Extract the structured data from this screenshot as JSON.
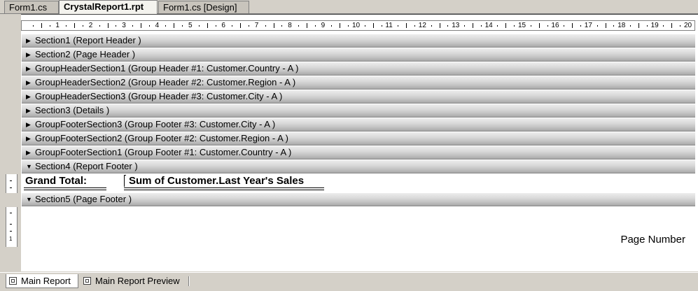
{
  "tabs": [
    {
      "label": "Form1.cs",
      "active": false
    },
    {
      "label": "CrystalReport1.rpt",
      "active": true
    },
    {
      "label": "Form1.cs [Design]",
      "active": false
    }
  ],
  "ruler": {
    "numbers": [
      "1",
      "2",
      "3",
      "4",
      "5",
      "6",
      "7",
      "8",
      "9",
      "10",
      "11",
      "12",
      "13",
      "14",
      "15",
      "16",
      "17",
      "18",
      "19",
      "20"
    ]
  },
  "sections": [
    {
      "label": "Section1 (Report Header )",
      "expanded": false
    },
    {
      "label": "Section2 (Page Header )",
      "expanded": false
    },
    {
      "label": "GroupHeaderSection1 (Group Header #1: Customer.Country - A )",
      "expanded": false
    },
    {
      "label": "GroupHeaderSection2 (Group Header #2: Customer.Region - A )",
      "expanded": false
    },
    {
      "label": "GroupHeaderSection3 (Group Header #3: Customer.City - A )",
      "expanded": false
    },
    {
      "label": "Section3 (Details )",
      "expanded": false
    },
    {
      "label": "GroupFooterSection3 (Group Footer #3: Customer.City - A )",
      "expanded": false
    },
    {
      "label": "GroupFooterSection2 (Group Footer #2: Customer.Region - A )",
      "expanded": false
    },
    {
      "label": "GroupFooterSection1 (Group Footer #1: Customer.Country - A )",
      "expanded": false
    },
    {
      "label": "Section4 (Report Footer )",
      "expanded": true
    },
    {
      "label": "Section5 (Page Footer )",
      "expanded": true
    }
  ],
  "report_footer": {
    "grand_total_label": "Grand Total:",
    "sum_field": "Sum of Customer.Last Year's Sales"
  },
  "page_footer": {
    "page_number_field": "Page Number"
  },
  "bottom_tabs": [
    {
      "label": "Main Report",
      "active": true
    },
    {
      "label": "Main Report Preview",
      "active": false
    }
  ],
  "icons": {
    "collapsed": "triangle-right",
    "expanded": "triangle-down",
    "report_tab": "report-icon"
  }
}
